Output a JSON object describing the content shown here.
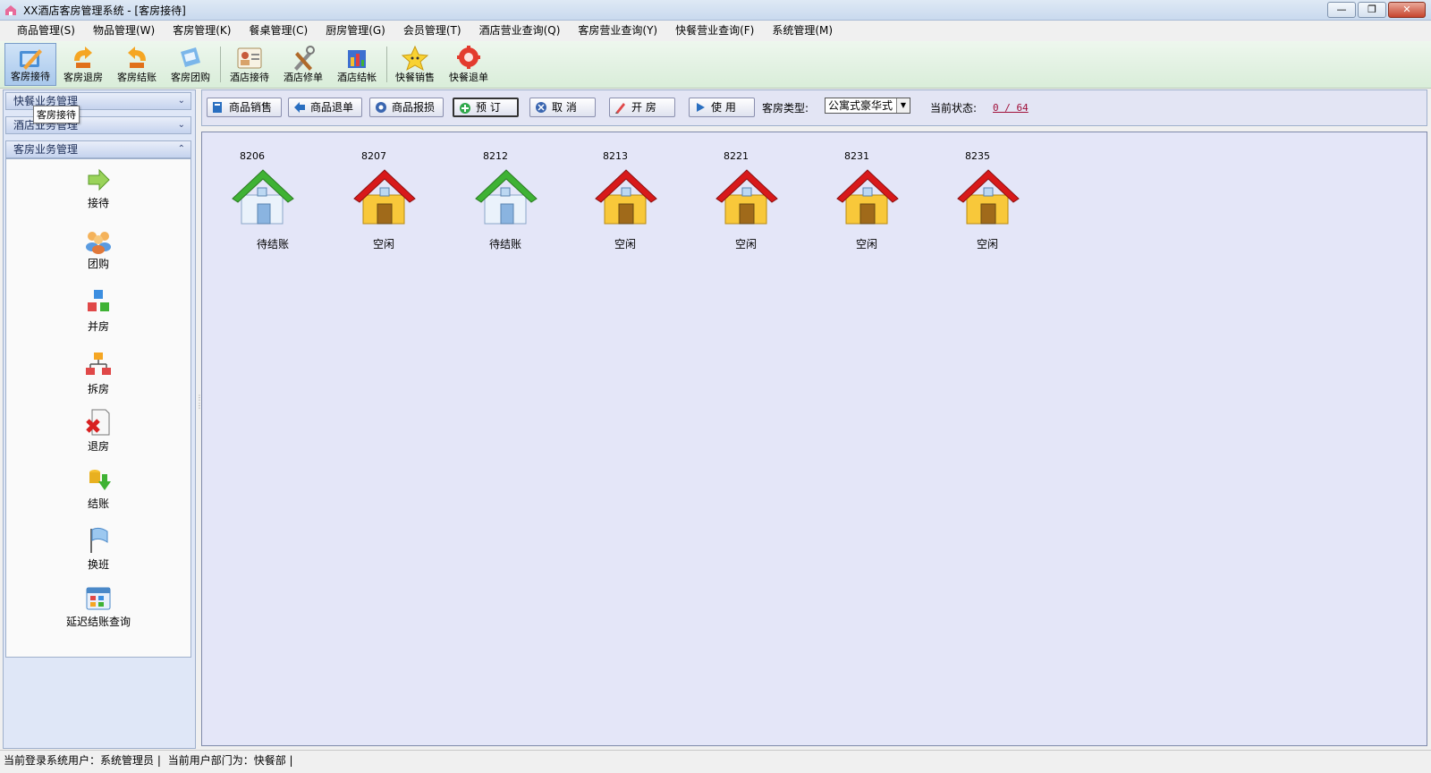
{
  "window": {
    "title": "XX酒店客房管理系统 - [客房接待]",
    "minimize": "—",
    "restore": "❐",
    "close": "✕"
  },
  "menu": [
    "商品管理(S)",
    "物品管理(W)",
    "客房管理(K)",
    "餐桌管理(C)",
    "厨房管理(G)",
    "会员管理(T)",
    "酒店营业查询(Q)",
    "客房营业查询(Y)",
    "快餐营业查询(F)",
    "系统管理(M)"
  ],
  "toolbar": [
    {
      "label": "客房接待",
      "icon": "reception-pen-icon"
    },
    {
      "label": "客房退房",
      "icon": "checkout-arrow-icon"
    },
    {
      "label": "客房结账",
      "icon": "settle-arrow-icon"
    },
    {
      "label": "客房团购",
      "icon": "group-purchase-icon"
    },
    {
      "label": "酒店接待",
      "icon": "hotel-reception-icon"
    },
    {
      "label": "酒店修单",
      "icon": "tools-icon"
    },
    {
      "label": "酒店结帐",
      "icon": "hotel-settle-icon"
    },
    {
      "label": "快餐销售",
      "icon": "star-icon"
    },
    {
      "label": "快餐退单",
      "icon": "gear-return-icon"
    }
  ],
  "tooltip": "客房接待",
  "left_panel": {
    "sections": [
      "快餐业务管理",
      "酒店业务管理",
      "客房业务管理"
    ],
    "items": [
      "接待",
      "团购",
      "并房",
      "拆房",
      "退房",
      "结账",
      "换班",
      "延迟结账查询"
    ]
  },
  "actions": {
    "buttons": [
      "商品销售",
      "商品退单",
      "商品报损",
      "预 订",
      "取 消",
      "开 房",
      "使 用"
    ],
    "room_type_label": "客房类型:",
    "room_type_value": "公寓式豪华式",
    "status_label": "当前状态:",
    "status_value": "0 / 64"
  },
  "rooms": [
    {
      "number": "8206",
      "status": "待结账",
      "kind": "green"
    },
    {
      "number": "8207",
      "status": "空闲",
      "kind": "red"
    },
    {
      "number": "8212",
      "status": "待结账",
      "kind": "green"
    },
    {
      "number": "8213",
      "status": "空闲",
      "kind": "red"
    },
    {
      "number": "8221",
      "status": "空闲",
      "kind": "red"
    },
    {
      "number": "8231",
      "status": "空闲",
      "kind": "red"
    },
    {
      "number": "8235",
      "status": "空闲",
      "kind": "red"
    }
  ],
  "statusbar": {
    "user": "当前登录系统用户：系统管理员 |",
    "dept": "当前用户部门为：快餐部 |"
  },
  "colors": {
    "room_free": "#d8191a",
    "room_pending": "#3fb234"
  }
}
